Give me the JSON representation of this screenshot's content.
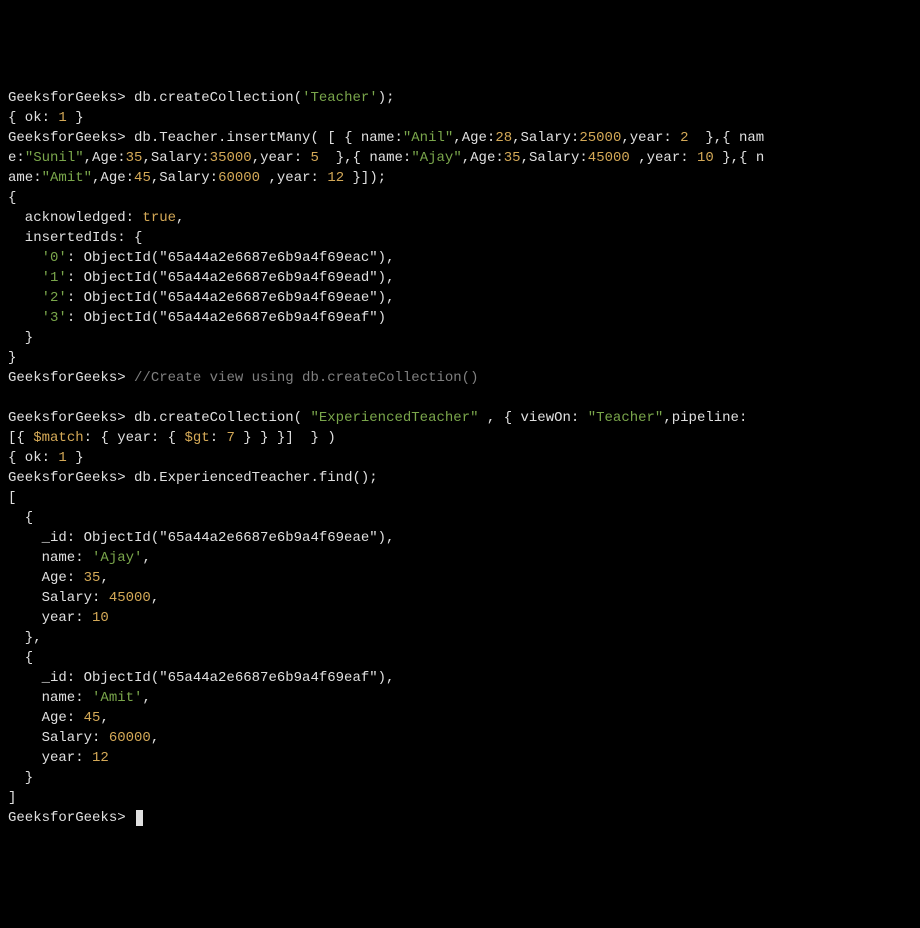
{
  "prompt": "GeeksforGeeks>",
  "cmd1": "db.createCollection(",
  "cmd1_arg": "'Teacher'",
  "cmd1_end": ");",
  "res1_open": "{ ok: ",
  "res1_val": "1",
  "res1_close": " }",
  "cmd2_a": "db.Teacher.insertMany( [ { name:",
  "cmd2_name1": "\"Anil\"",
  "cmd2_b": ",Age:",
  "cmd2_age1": "28",
  "cmd2_c": ",Salary:",
  "cmd2_sal1": "25000",
  "cmd2_d": ",year: ",
  "cmd2_yr1": "2",
  "cmd2_e": "  },{ nam",
  "cmd2_f": "e:",
  "cmd2_name2": "\"Sunil\"",
  "cmd2_g": ",Age:",
  "cmd2_age2": "35",
  "cmd2_h": ",Salary:",
  "cmd2_sal2": "35000",
  "cmd2_i": ",year: ",
  "cmd2_yr2": "5",
  "cmd2_j": "  },{ name:",
  "cmd2_name3": "\"Ajay\"",
  "cmd2_k": ",Age:",
  "cmd2_age3": "35",
  "cmd2_l": ",Salary:",
  "cmd2_sal3": "45000",
  "cmd2_m": " ,year: ",
  "cmd2_yr3": "10",
  "cmd2_n": " },{ n",
  "cmd2_o": "ame:",
  "cmd2_name4": "\"Amit\"",
  "cmd2_p": ",Age:",
  "cmd2_age4": "45",
  "cmd2_q": ",Salary:",
  "cmd2_sal4": "60000",
  "cmd2_r": " ,year: ",
  "cmd2_yr4": "12",
  "cmd2_s": " }]);",
  "res2_open": "{",
  "res2_ack_lbl": "  acknowledged: ",
  "res2_ack_val": "true",
  "res2_ack_end": ",",
  "res2_ids_lbl": "  insertedIds: {",
  "res2_id0_k": "'0'",
  "res2_id0_v": ": ObjectId(\"65a44a2e6687e6b9a4f69eac\"),",
  "res2_id1_k": "'1'",
  "res2_id1_v": ": ObjectId(\"65a44a2e6687e6b9a4f69ead\"),",
  "res2_id2_k": "'2'",
  "res2_id2_v": ": ObjectId(\"65a44a2e6687e6b9a4f69eae\"),",
  "res2_id3_k": "'3'",
  "res2_id3_v": ": ObjectId(\"65a44a2e6687e6b9a4f69eaf\")",
  "res2_ids_close": "  }",
  "res2_close": "}",
  "comment3": "//Create view using db.createCollection()",
  "cmd4_a": "db.createCollection( ",
  "cmd4_name": "\"ExperiencedTeacher\"",
  "cmd4_b": " , { viewOn: ",
  "cmd4_view": "\"Teacher\"",
  "cmd4_c": ",pipeline:",
  "cmd4_d": "[{ ",
  "cmd4_match": "$match",
  "cmd4_e": ": { year: { ",
  "cmd4_gt": "$gt",
  "cmd4_f": ": ",
  "cmd4_gtval": "7",
  "cmd4_g": " } } }]  } )",
  "res4_open": "{ ok: ",
  "res4_val": "1",
  "res4_close": " }",
  "cmd5": "db.ExperiencedTeacher.find();",
  "res5_open": "[",
  "res5_obj_open": "  {",
  "res5_1_id_lbl": "    _id: ObjectId(\"65a44a2e6687e6b9a4f69eae\"),",
  "res5_1_name_lbl": "    name: ",
  "res5_1_name_val": "'Ajay'",
  "res5_1_name_end": ",",
  "res5_1_age_lbl": "    Age: ",
  "res5_1_age_val": "35",
  "res5_1_age_end": ",",
  "res5_1_sal_lbl": "    Salary: ",
  "res5_1_sal_val": "45000",
  "res5_1_sal_end": ",",
  "res5_1_yr_lbl": "    year: ",
  "res5_1_yr_val": "10",
  "res5_obj_close_comma": "  },",
  "res5_2_id_lbl": "    _id: ObjectId(\"65a44a2e6687e6b9a4f69eaf\"),",
  "res5_2_name_lbl": "    name: ",
  "res5_2_name_val": "'Amit'",
  "res5_2_name_end": ",",
  "res5_2_age_lbl": "    Age: ",
  "res5_2_age_val": "45",
  "res5_2_age_end": ",",
  "res5_2_sal_lbl": "    Salary: ",
  "res5_2_sal_val": "60000",
  "res5_2_sal_end": ",",
  "res5_2_yr_lbl": "    year: ",
  "res5_2_yr_val": "12",
  "res5_obj_close": "  }",
  "res5_close": "]"
}
